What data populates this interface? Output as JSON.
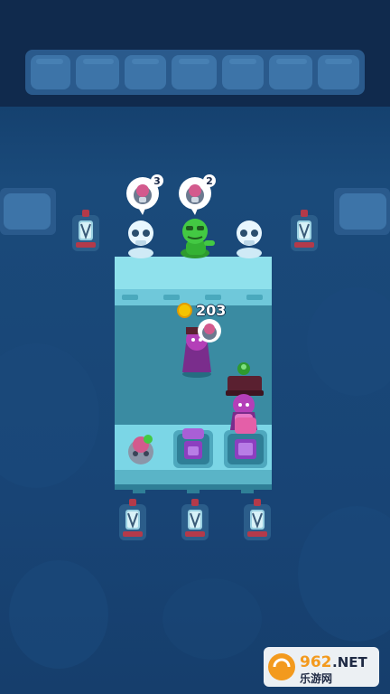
{
  "game": {
    "coins": "203",
    "queue": [
      {
        "type": "skeleton",
        "wants": "skull-drink",
        "count": "3"
      },
      {
        "type": "zombie",
        "wants": "skull-drink",
        "count": "2"
      },
      {
        "type": "skeleton",
        "wants": "none",
        "count": ""
      }
    ],
    "stations": [
      "skull-drink",
      "purple-potion",
      "purple-potion-filled"
    ],
    "workers": [
      "vampire-carrying-drink",
      "hatted-vampire-with-lilypad"
    ]
  },
  "watermark": {
    "brand": "962",
    "tld": ".NET",
    "subtitle": "乐游网"
  },
  "colors": {
    "background": "#163c6a",
    "tile_light": "#8fe1ec",
    "floor": "#3a8ba2",
    "coin": "#f4c400",
    "watermark_orange": "#f39a1e"
  }
}
